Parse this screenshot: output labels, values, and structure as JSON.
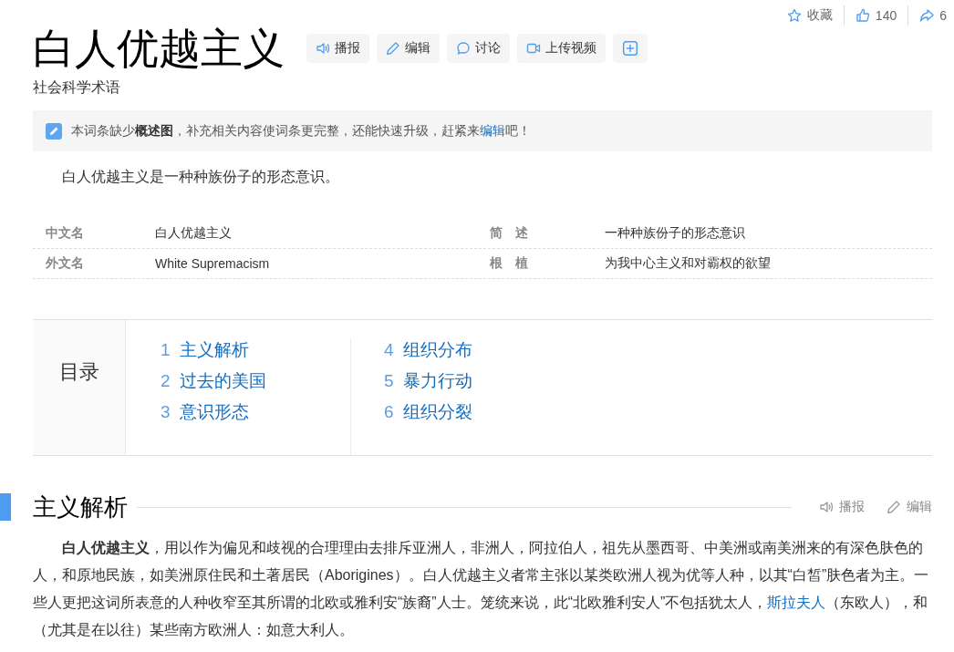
{
  "top_actions": [
    {
      "kind": "star",
      "label": "收藏"
    },
    {
      "kind": "like",
      "label": "140"
    },
    {
      "kind": "share",
      "label": "6"
    }
  ],
  "title": "白人优越主义",
  "tool_buttons": [
    {
      "kind": "speaker",
      "label": "播报"
    },
    {
      "kind": "pencil",
      "label": "编辑"
    },
    {
      "kind": "bubble",
      "label": "讨论"
    },
    {
      "kind": "video",
      "label": "上传视频"
    },
    {
      "kind": "add"
    }
  ],
  "subtitle": "社会科学术语",
  "notice": {
    "parts": [
      {
        "kind": "text",
        "text": "本词条缺少**概述图**，补充相关内容使词条更完整，还能快速升级，赶紧来"
      },
      {
        "kind": "link",
        "text": "编辑"
      },
      {
        "kind": "text",
        "text": "吧！"
      }
    ]
  },
  "summary": "白人优越主义是一种种族份子的形态意识。",
  "infobox": [
    {
      "name": "中文名",
      "value": "白人优越主义"
    },
    {
      "name": "外文名",
      "value": "White Supremacism"
    },
    {
      "name": "简　述",
      "value": "一种种族份子的形态意识"
    },
    {
      "name": "根　植",
      "value": "为我中心主义和对霸权的欲望"
    }
  ],
  "toc": {
    "title": "目录",
    "items": [
      {
        "number": "1",
        "label": "主义解析"
      },
      {
        "number": "2",
        "label": "过去的美国"
      },
      {
        "number": "3",
        "label": "意识形态"
      },
      {
        "number": "4",
        "label": "组织分布"
      },
      {
        "number": "5",
        "label": "暴力行动"
      },
      {
        "number": "6",
        "label": "组织分裂"
      }
    ]
  },
  "section": {
    "title": "主义解析",
    "actions": [
      {
        "kind": "speaker",
        "label": "播报"
      },
      {
        "kind": "pencil",
        "label": "编辑"
      }
    ],
    "paragraph": [
      {
        "kind": "text",
        "text": "**白人优越主义**，用以作为偏见和歧视的合理理由去排斥亚洲人，非洲人，阿拉伯人，祖先从墨西哥、中美洲或南美洲来的有深色肤色的人，和原地民族，如美洲原住民和土著居民（Aborigines）。白人优越主义者常主张以某类欧洲人视为优等人种，以其“白皙”肤色者为主。一些人更把这词所表意的人种收窄至其所谓的北欧或雅利安“族裔”人士。笼统来说，此“北欧雅利安人”不包括犹太人，"
      },
      {
        "kind": "link",
        "text": "斯拉夫人"
      },
      {
        "kind": "text",
        "text": "（东欧人），和（尤其是在以往）某些南方欧洲人：如意大利人。"
      }
    ]
  }
}
